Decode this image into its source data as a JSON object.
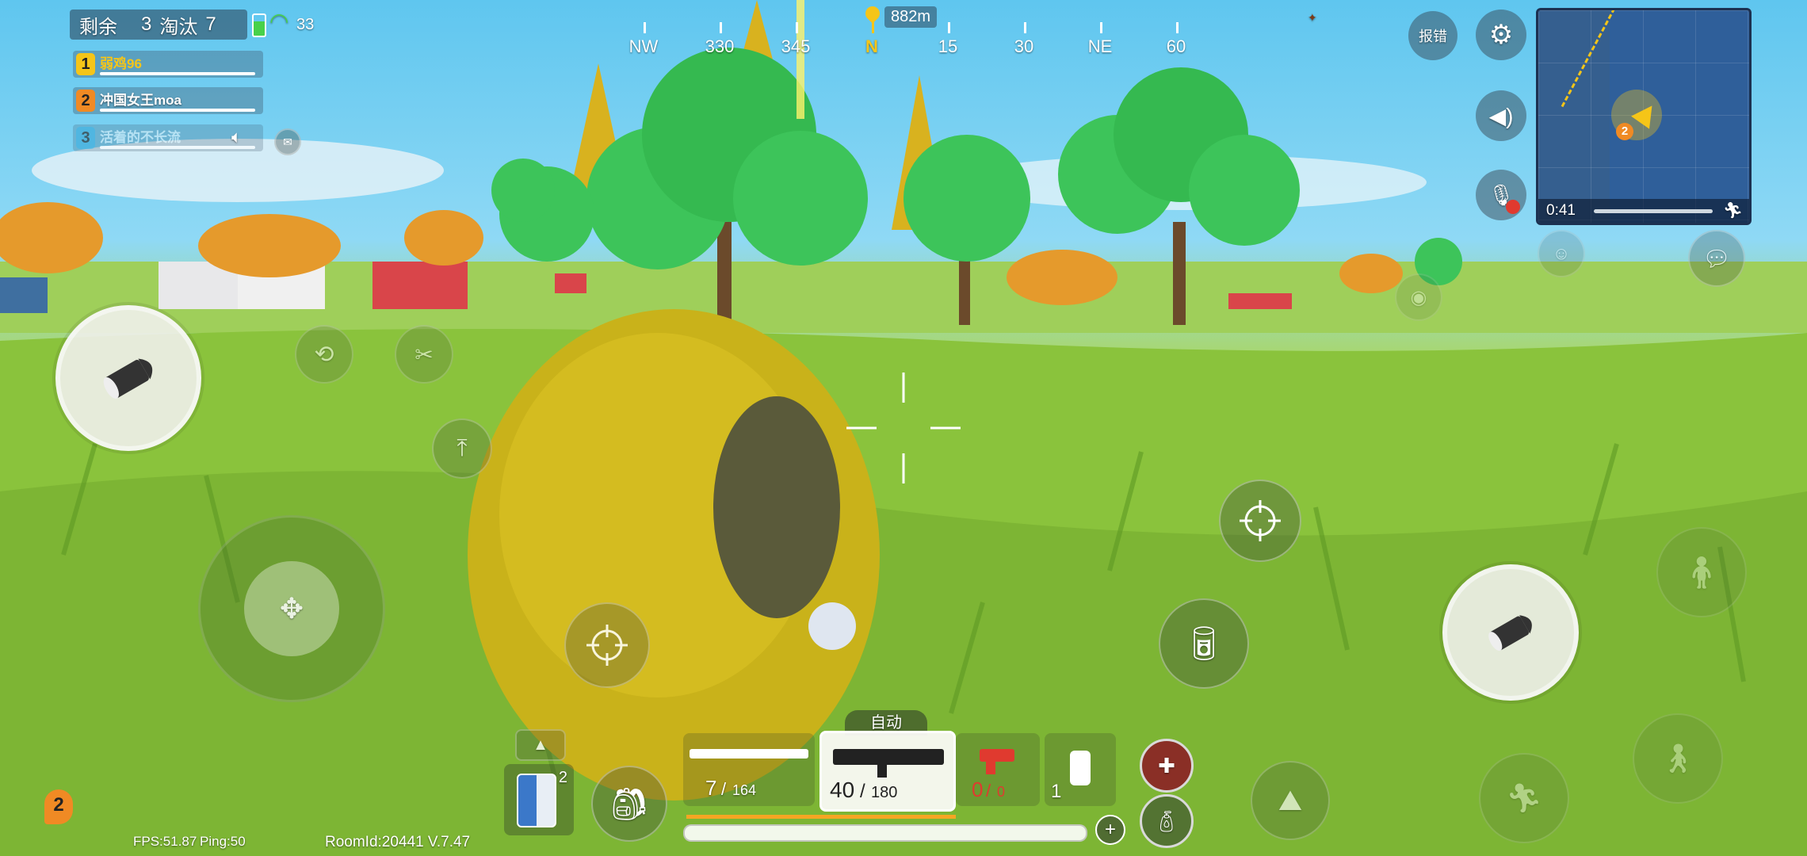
{
  "top_left": {
    "remaining_label": "剩余",
    "remaining_count": "3",
    "eliminated_label": "淘汰",
    "eliminated_count": "7",
    "signal_value": "33"
  },
  "team": [
    {
      "num": "1",
      "name": "弱鸡96",
      "color": "#f5c518",
      "name_color": "#f5c518"
    },
    {
      "num": "2",
      "name": "冲国女王moa",
      "color": "#f08a24",
      "name_color": "#ffffff"
    },
    {
      "num": "3",
      "name": "活着的不长流",
      "color": "#3aa9d8",
      "name_color": "#bcdff0"
    }
  ],
  "compass": {
    "distance": "882m",
    "labels": [
      "NW",
      "330",
      "345",
      "N",
      "15",
      "30",
      "NE",
      "60"
    ],
    "active_label_color": "#f5c518"
  },
  "top_right": {
    "report_label": "报错",
    "minimap_time": "0:41",
    "minimap_marker": "2"
  },
  "bottom": {
    "fps": "FPS:51.87",
    "ping": "Ping:50",
    "room": "RoomId:20441 V.7.47",
    "team_marker": "2",
    "fire_mode": "自动",
    "armor_count": "2",
    "weapon1_ammo": "7",
    "weapon1_reserve": "164",
    "weapon2_ammo": "40",
    "weapon2_reserve": "180",
    "weapon3_ammo": "0",
    "weapon3_reserve": "0",
    "grenade_count": "1"
  },
  "colors": {
    "ammo_bar": "#f5a623",
    "pistol_red": "#e03a2f",
    "accent_yellow": "#f5c518"
  }
}
